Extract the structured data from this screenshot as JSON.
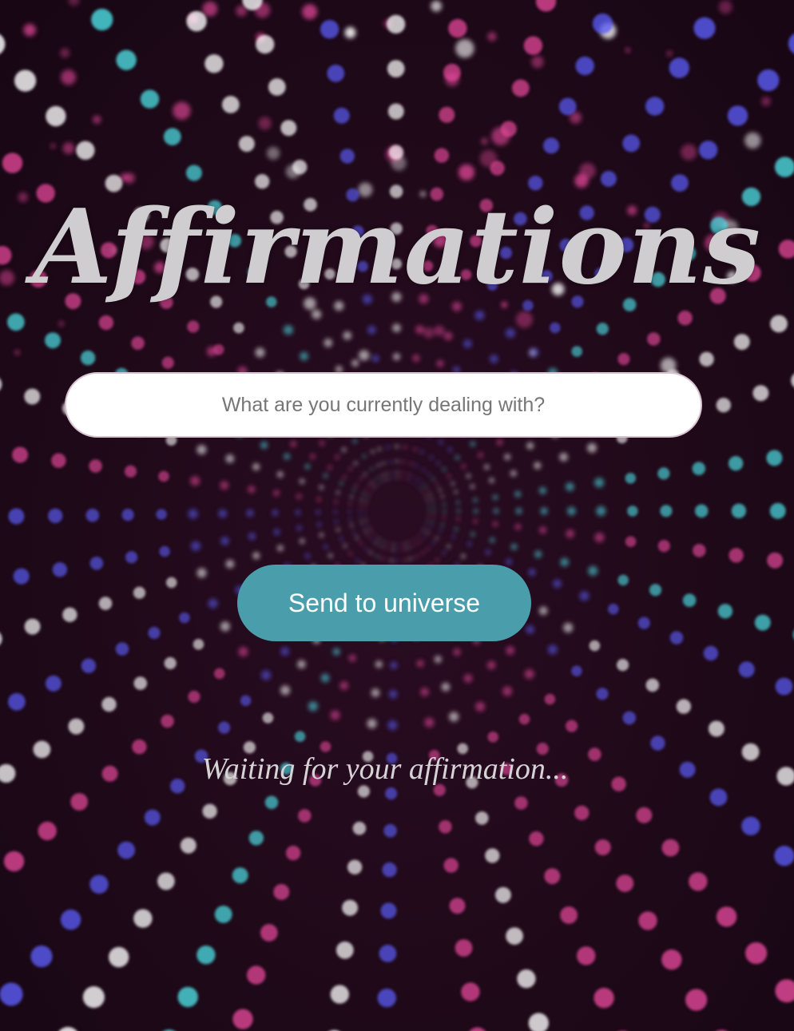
{
  "app": {
    "title": "Affirmations"
  },
  "form": {
    "placeholder": "What are you currently dealing with?",
    "value": "",
    "submit_label": "Send to universe"
  },
  "status": {
    "message": "Waiting for your affirmation..."
  },
  "background": {
    "base_color": "#1e0918",
    "dot_colors": [
      "#e4489a",
      "#ffffff",
      "#4de0e6",
      "#5a5cf5"
    ]
  },
  "theme": {
    "accent": "#4a9eab",
    "title_color": "#cfcdcf"
  }
}
